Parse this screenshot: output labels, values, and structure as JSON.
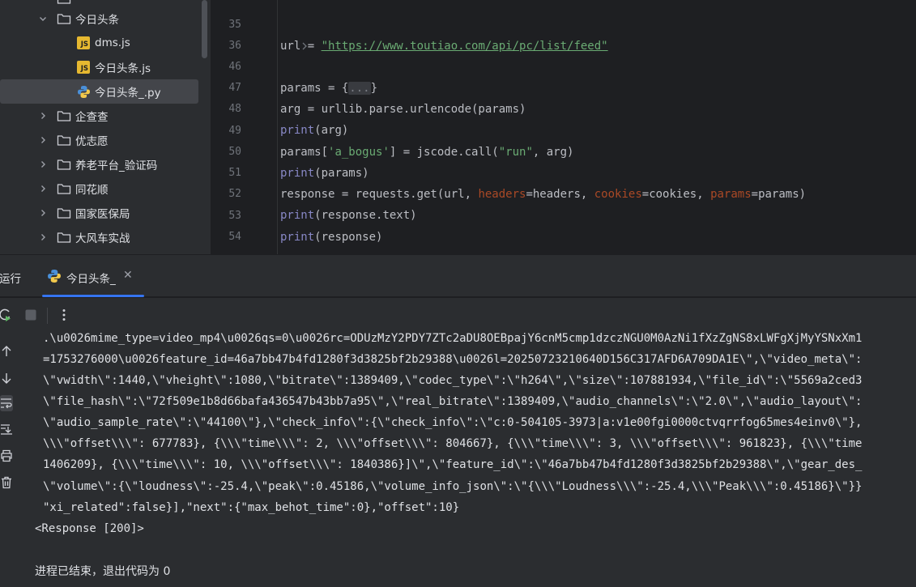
{
  "project_tree": {
    "items": [
      {
        "label": "今日头条",
        "type": "folder",
        "expanded": true
      },
      {
        "label": "dms.js",
        "type": "js"
      },
      {
        "label": "今日头条.js",
        "type": "js"
      },
      {
        "label": "今日头条_.py",
        "type": "python",
        "selected": true
      },
      {
        "label": "企查查",
        "type": "folder",
        "expanded": false
      },
      {
        "label": "优志愿",
        "type": "folder",
        "expanded": false
      },
      {
        "label": "养老平台_验证码",
        "type": "folder",
        "expanded": false
      },
      {
        "label": "同花顺",
        "type": "folder",
        "expanded": false
      },
      {
        "label": "国家医保局",
        "type": "folder",
        "expanded": false
      },
      {
        "label": "大风车实战",
        "type": "folder",
        "expanded": false
      }
    ],
    "js_badge": "JS"
  },
  "editor": {
    "lines": [
      {
        "num": "35",
        "parts": [
          "url = ",
          "\"https://www.toutiao.com/api/pc/list/feed\""
        ]
      },
      {
        "num": "36",
        "parts": [
          "params = {",
          "...",
          "}"
        ]
      },
      {
        "num": "46",
        "parts": [
          ""
        ]
      },
      {
        "num": "47",
        "parts": [
          "arg = urllib.parse.urlencode(params)"
        ]
      },
      {
        "num": "48",
        "parts": [
          "print",
          "(arg)"
        ]
      },
      {
        "num": "49",
        "parts": [
          "params[",
          "'a_bogus'",
          "] = jscode.call(",
          "\"run\"",
          ", arg)"
        ]
      },
      {
        "num": "50",
        "parts": [
          "print",
          "(params)"
        ]
      },
      {
        "num": "51",
        "parts": [
          "response = requests.get(url, ",
          "headers",
          "=headers, ",
          "cookies",
          "=cookies, ",
          "params",
          "=params)"
        ]
      },
      {
        "num": "52",
        "parts": [
          "print",
          "(response.text)"
        ]
      },
      {
        "num": "53",
        "parts": [
          "print",
          "(response)"
        ]
      },
      {
        "num": "54",
        "parts": [
          ""
        ]
      }
    ]
  },
  "run_panel": {
    "title": "运行",
    "tab_label": "今日头条_",
    "close_glyph": "✕",
    "output_lines": [
      ".\\u0026mime_type=video_mp4\\u0026qs=0\\u0026rc=ODUzMzY2PDY7ZTc2aDU8OEBpajY6cnM5cmp1dzczNGU0M0AzNi1fXzZgNS8xLWFgXjMyYSNxXm1",
      "=1753276000\\u0026feature_id=46a7bb47b4fd1280f3d3825bf2b29388\\u0026l=20250723210640D156C317AFD6A709DA1E\\\",\\\"video_meta\\\":",
      "\\\"vwidth\\\":1440,\\\"vheight\\\":1080,\\\"bitrate\\\":1389409,\\\"codec_type\\\":\\\"h264\\\",\\\"size\\\":107881934,\\\"file_id\\\":\\\"5569a2ced3",
      "\\\"file_hash\\\":\\\"72f509e1b8d66bafa436547b43bb7a95\\\",\\\"real_bitrate\\\":1389409,\\\"audio_channels\\\":\\\"2.0\\\",\\\"audio_layout\\\":",
      "\\\"audio_sample_rate\\\":\\\"44100\\\"},\\\"check_info\\\":{\\\"check_info\\\":\\\"c:0-504105-3973|a:v1e00fgi0000ctvqrrfog65mes4einv0\\\"},",
      "\\\\\\\"offset\\\\\\\": 677783}, {\\\\\\\"time\\\\\\\": 2, \\\\\\\"offset\\\\\\\": 804667}, {\\\\\\\"time\\\\\\\": 3, \\\\\\\"offset\\\\\\\": 961823}, {\\\\\\\"time",
      "1406209}, {\\\\\\\"time\\\\\\\": 10, \\\\\\\"offset\\\\\\\": 1840386}]\\\",\\\"feature_id\\\":\\\"46a7bb47b4fd1280f3d3825bf2b29388\\\",\\\"gear_des_",
      "\\\"volume\\\":{\\\"loudness\\\":-25.4,\\\"peak\\\":0.45186,\\\"volume_info_json\\\":\\\"{\\\\\\\"Loudness\\\\\\\":-25.4,\\\\\\\"Peak\\\\\\\":0.45186}\\\"}}",
      "\"xi_related\":false}],\"next\":{\"max_behot_time\":0},\"offset\":10}",
      "<Response [200]>",
      "",
      "进程已结束，退出代码为 0"
    ]
  },
  "colors": {
    "accent": "#3574f0",
    "string": "#6aab73",
    "builtin": "#8888c6",
    "kwarg": "#aa4926"
  }
}
